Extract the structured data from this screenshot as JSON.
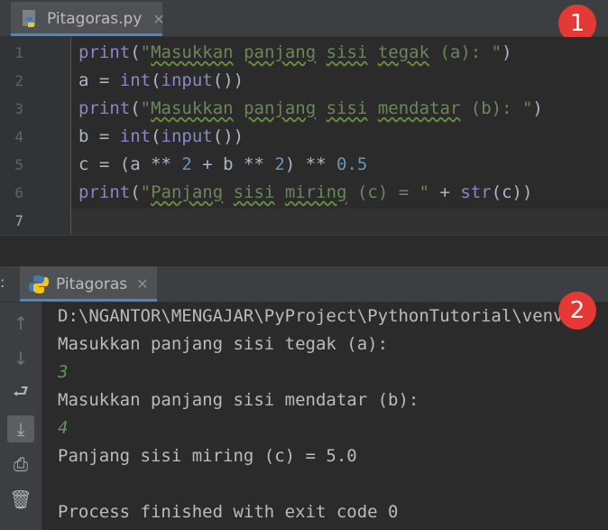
{
  "editor": {
    "tab_label": "Pitagoras.py",
    "tab_close": "✕",
    "line_numbers": [
      "1",
      "2",
      "3",
      "4",
      "5",
      "6",
      "7"
    ],
    "lines": [
      [
        {
          "t": "print",
          "c": "fn"
        },
        {
          "t": "(",
          "c": ""
        },
        {
          "t": "\"",
          "c": "str"
        },
        {
          "t": "Masukkan",
          "c": "str sq"
        },
        {
          "t": " ",
          "c": "str"
        },
        {
          "t": "panjang",
          "c": "str sq"
        },
        {
          "t": " ",
          "c": "str"
        },
        {
          "t": "sisi",
          "c": "str sq"
        },
        {
          "t": " ",
          "c": "str"
        },
        {
          "t": "tegak",
          "c": "str sq"
        },
        {
          "t": " (a): \"",
          "c": "str"
        },
        {
          "t": ")",
          "c": ""
        }
      ],
      [
        {
          "t": "a = ",
          "c": ""
        },
        {
          "t": "int",
          "c": "fn"
        },
        {
          "t": "(",
          "c": ""
        },
        {
          "t": "input",
          "c": "fn"
        },
        {
          "t": "())",
          "c": ""
        }
      ],
      [
        {
          "t": "print",
          "c": "fn"
        },
        {
          "t": "(",
          "c": ""
        },
        {
          "t": "\"",
          "c": "str"
        },
        {
          "t": "Masukkan",
          "c": "str sq"
        },
        {
          "t": " ",
          "c": "str"
        },
        {
          "t": "panjang",
          "c": "str sq"
        },
        {
          "t": " ",
          "c": "str"
        },
        {
          "t": "sisi",
          "c": "str sq"
        },
        {
          "t": " ",
          "c": "str"
        },
        {
          "t": "mendatar",
          "c": "str sq"
        },
        {
          "t": " (b): \"",
          "c": "str"
        },
        {
          "t": ")",
          "c": ""
        }
      ],
      [
        {
          "t": "b = ",
          "c": ""
        },
        {
          "t": "int",
          "c": "fn"
        },
        {
          "t": "(",
          "c": ""
        },
        {
          "t": "input",
          "c": "fn"
        },
        {
          "t": "())",
          "c": ""
        }
      ],
      [
        {
          "t": "c = (a ** ",
          "c": ""
        },
        {
          "t": "2",
          "c": "num"
        },
        {
          "t": " + b ** ",
          "c": ""
        },
        {
          "t": "2",
          "c": "num"
        },
        {
          "t": ") ** ",
          "c": ""
        },
        {
          "t": "0.5",
          "c": "num"
        }
      ],
      [
        {
          "t": "print",
          "c": "fn"
        },
        {
          "t": "(",
          "c": ""
        },
        {
          "t": "\"",
          "c": "str"
        },
        {
          "t": "Panjang",
          "c": "str sq"
        },
        {
          "t": " ",
          "c": "str"
        },
        {
          "t": "sisi",
          "c": "str sq"
        },
        {
          "t": " ",
          "c": "str"
        },
        {
          "t": "miring",
          "c": "str sq"
        },
        {
          "t": " (c) = \"",
          "c": "str"
        },
        {
          "t": " + ",
          "c": ""
        },
        {
          "t": "str",
          "c": "fn"
        },
        {
          "t": "(c))",
          "c": ""
        }
      ],
      []
    ]
  },
  "badges": {
    "one": "1",
    "two": "2"
  },
  "run": {
    "colon": ":",
    "tab_label": "Pitagoras",
    "tab_close": "✕",
    "toolbar": [
      {
        "name": "up-arrow-icon",
        "glyph": "↑",
        "dim": true
      },
      {
        "name": "down-arrow-icon",
        "glyph": "↓",
        "dim": true
      },
      {
        "name": "soft-wrap-icon",
        "glyph": "⮐",
        "dim": false
      },
      {
        "name": "scroll-to-end-icon",
        "glyph": "⤓",
        "dim": false,
        "selected": true
      },
      {
        "name": "print-icon",
        "glyph": "⎙",
        "dim": false
      },
      {
        "name": "trash-icon",
        "glyph": "🗑",
        "dim": false
      }
    ],
    "console_lines": [
      {
        "text": "D:\\NGANTOR\\MENGAJAR\\PyProject\\PythonTutorial\\venv\\S",
        "user": false
      },
      {
        "text": "Masukkan panjang sisi tegak (a):",
        "user": false
      },
      {
        "text": "3",
        "user": true
      },
      {
        "text": "Masukkan panjang sisi mendatar (b):",
        "user": false
      },
      {
        "text": "4",
        "user": true
      },
      {
        "text": "Panjang sisi miring (c) = 5.0",
        "user": false
      },
      {
        "text": "",
        "user": false
      },
      {
        "text": "Process finished with exit code 0",
        "user": false
      }
    ]
  }
}
